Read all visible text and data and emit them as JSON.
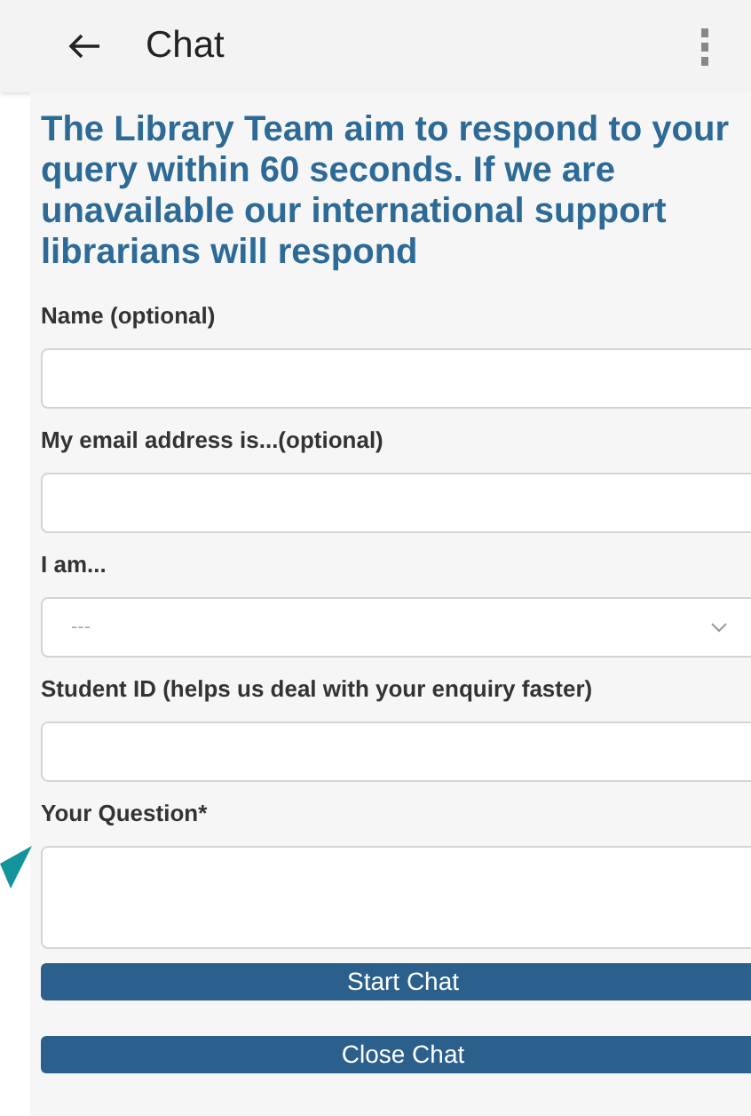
{
  "header": {
    "title": "Chat"
  },
  "intro": "The Library Team aim to respond to your query within 60 seconds. If we are unavailable our international support librarians will respond",
  "fields": [
    {
      "kind": "text",
      "label": "Name (optional)"
    },
    {
      "kind": "text",
      "label": "My email address is...(optional)"
    },
    {
      "kind": "select",
      "label": "I am...",
      "value": "---"
    },
    {
      "kind": "text",
      "label": "Student ID (helps us deal with your enquiry faster)"
    },
    {
      "kind": "textarea",
      "label": "Your Question*"
    }
  ],
  "buttons": [
    "Start Chat",
    "Close Chat"
  ]
}
